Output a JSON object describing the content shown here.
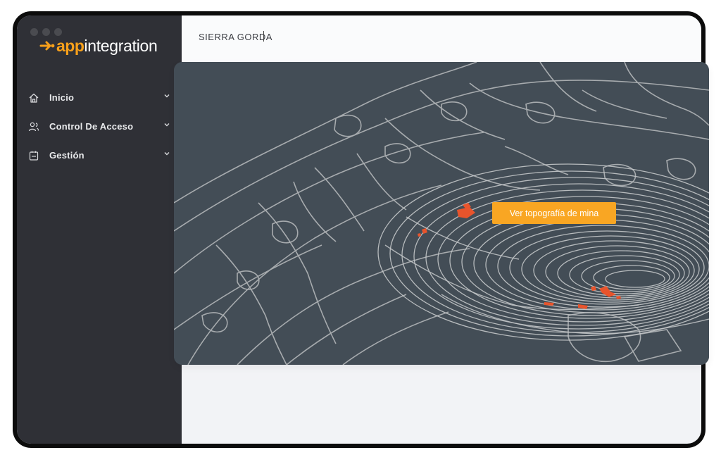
{
  "app": {
    "logo_app": "app",
    "logo_rest": "integration"
  },
  "sidebar": {
    "items": [
      {
        "label": "Inicio",
        "icon": "home-icon"
      },
      {
        "label": "Control De Acceso",
        "icon": "users-icon"
      },
      {
        "label": "Gestión",
        "icon": "clipboard-icon"
      }
    ]
  },
  "header": {
    "site_value": "SIERRA GORDA"
  },
  "main": {
    "map_button_label": "Ver topografía de mina"
  },
  "colors": {
    "accent": "#f7a01b",
    "sidebar_bg": "#2f3036",
    "map_bg": "#434d56",
    "map_lines": "#b9bcbe",
    "hazard": "#e8542c"
  }
}
